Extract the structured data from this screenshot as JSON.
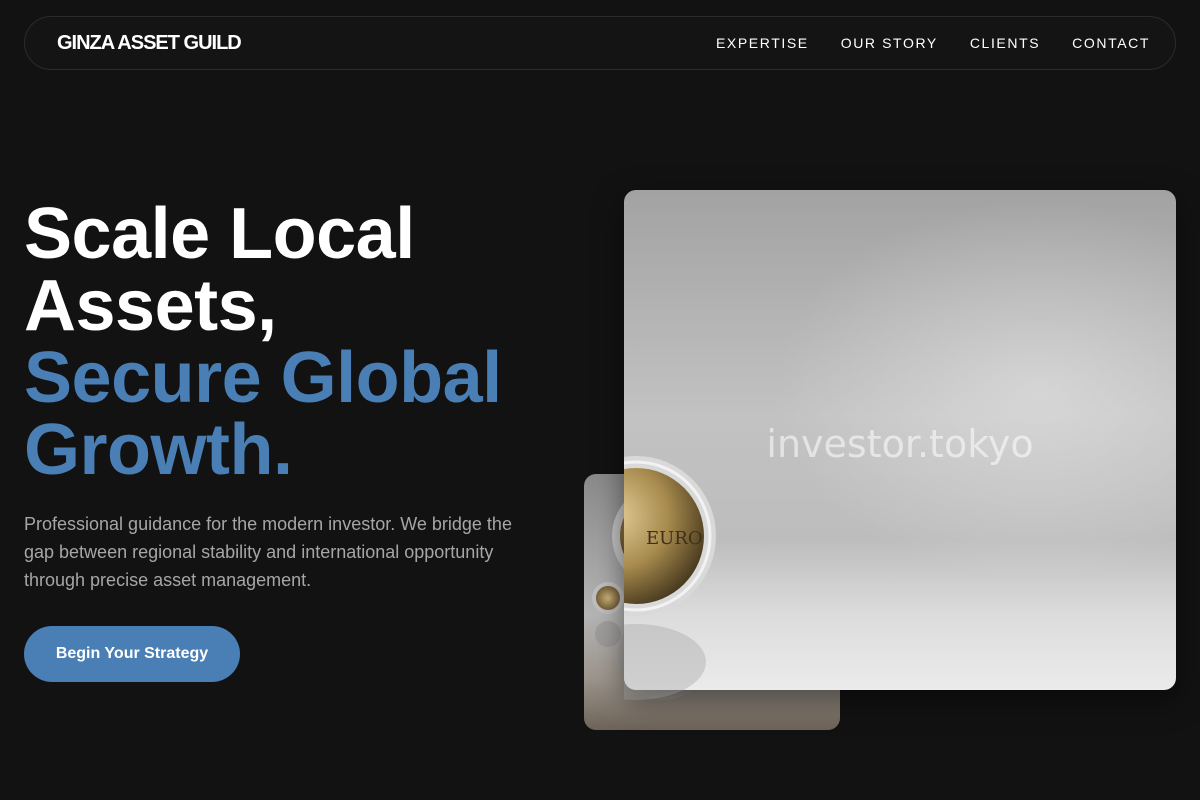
{
  "header": {
    "logo": "GINZA ASSET GUILD",
    "nav": [
      "EXPERTISE",
      "OUR STORY",
      "CLIENTS",
      "CONTACT"
    ]
  },
  "hero": {
    "title_lines": [
      "Scale Local",
      "Assets,"
    ],
    "title_accent_lines": [
      "Secure Global",
      "Growth."
    ],
    "description": "Professional guidance for the modern investor. We bridge the gap between regional stability and international opportunity through precise asset management.",
    "cta_label": "Begin Your Strategy"
  },
  "images": {
    "main_watermark": "investor.tokyo",
    "coin_label": "EURO"
  },
  "colors": {
    "background": "#121212",
    "accent": "#4a7fb5",
    "text_muted": "#a6a6a6"
  }
}
